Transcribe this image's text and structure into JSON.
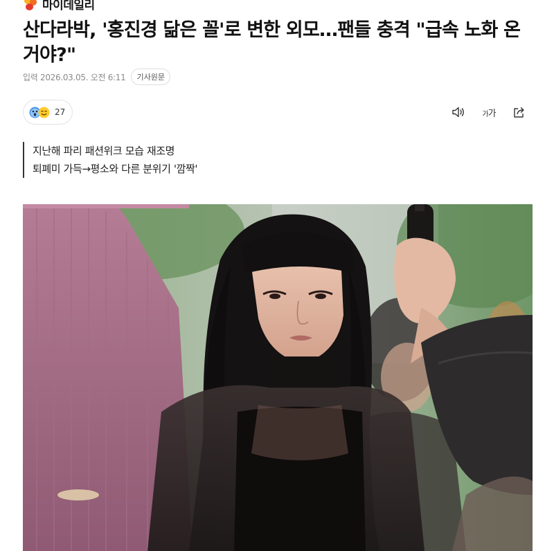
{
  "source": {
    "name": "마이데일리",
    "logo_icon": "mydaily-logo-icon",
    "colors": {
      "orange": "#f26b21",
      "yellow": "#f6b51e",
      "red": "#e63a2e"
    }
  },
  "article": {
    "headline": "산다라박, '홍진경 닮은 꼴'로 변한 외모…팬들 충격 \"급속 노화 온 거야?\"",
    "meta": {
      "date": "입력 2026.03.05. 오전 6:11",
      "original_button": "기사원문"
    },
    "reactions": {
      "icons": [
        "surprised-emoji-icon",
        "smile-emoji-icon"
      ],
      "count": "27"
    },
    "tools": {
      "listen_icon": "speaker-icon",
      "font_size_label": "가",
      "font_size_label_small": "가",
      "share_icon": "share-icon"
    },
    "subtitles": [
      "지난해 파리 패션위크 모습 재조명",
      "퇴폐미 가득→평소와 다른 분위기 '깜짝'"
    ],
    "photo": {
      "icon": "article-photo"
    }
  }
}
